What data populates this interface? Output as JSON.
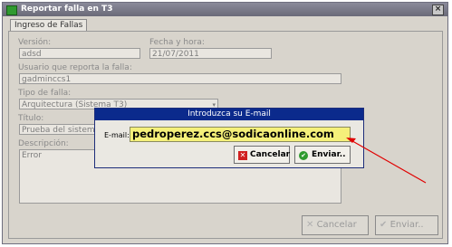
{
  "window": {
    "title": "Reportar falla en T3",
    "close_glyph": "×"
  },
  "tab": {
    "label": "Ingreso de Fallas"
  },
  "form": {
    "version_label": "Versión:",
    "version_value": "adsd",
    "fecha_label": "Fecha y hora:",
    "fecha_value": "21/07/2011",
    "usuario_label": "Usuario que reporta la falla:",
    "usuario_value": "gadminccs1",
    "tipo_label": "Tipo de falla:",
    "tipo_value": "Arquitectura (Sistema T3)",
    "titulo_label": "Título:",
    "titulo_value": "Prueba del sistema",
    "descripcion_label": "Descripción:",
    "descripcion_value": "Error"
  },
  "buttons": {
    "cancelar": "Cancelar",
    "enviar": "Enviar.."
  },
  "dialog": {
    "title": "Introduzca su E-mail",
    "email_label": "E-mail:",
    "email_value": "pedroperez.ccs@sodicaonline.com",
    "cancelar": "Cancelar",
    "enviar": "Enviar.."
  },
  "colors": {
    "dialog_title_bg": "#0b2a8c",
    "email_field_bg": "#f5f07a",
    "annotation_arrow": "#e00000"
  }
}
